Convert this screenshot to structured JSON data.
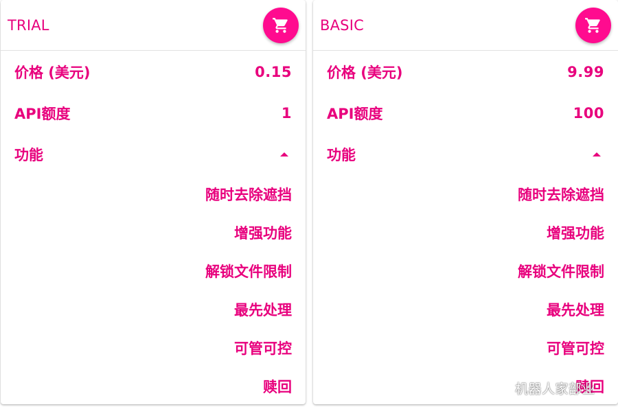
{
  "accent_color": "#e8007d",
  "cart_button_color": "#ff0b8f",
  "plans": [
    {
      "name": "TRIAL",
      "cart_icon": "shopping-cart-icon",
      "price_label": "价格 (美元)",
      "price_value": "0.15",
      "quota_label": "API额度",
      "quota_value": "1",
      "features_label": "功能",
      "features_toggle_icon": "caret-up-icon",
      "features": [
        "随时去除遮挡",
        "增强功能",
        "解锁文件限制",
        "最先处理",
        "可管可控",
        "赎回"
      ]
    },
    {
      "name": "BASIC",
      "cart_icon": "shopping-cart-icon",
      "price_label": "价格 (美元)",
      "price_value": "9.99",
      "quota_label": "API额度",
      "quota_value": "100",
      "features_label": "功能",
      "features_toggle_icon": "caret-up-icon",
      "features": [
        "随时去除遮挡",
        "增强功能",
        "解锁文件限制",
        "最先处理",
        "可管可控",
        "赎回"
      ]
    }
  ],
  "watermark": "机器人家部业"
}
